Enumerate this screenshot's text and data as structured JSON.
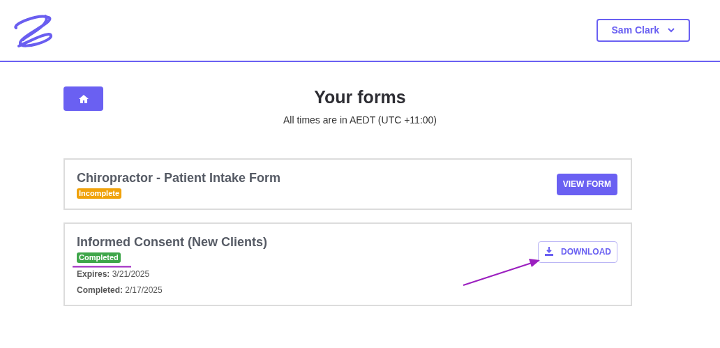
{
  "header": {
    "user_menu": {
      "label": "Sam Clark"
    }
  },
  "page": {
    "title": "Your forms",
    "subtitle": "All times are in AEDT (UTC +11:00)"
  },
  "forms": [
    {
      "title": "Chiropractor - Patient Intake Form",
      "status": {
        "kind": "incomplete",
        "label": "Incomplete"
      },
      "action": {
        "kind": "primary",
        "label": "VIEW FORM"
      }
    },
    {
      "title": "Informed Consent (New Clients)",
      "status": {
        "kind": "completed",
        "label": "Completed"
      },
      "details": [
        "**Expires:** 3/21/2025",
        "**Completed:** 2/17/2025"
      ],
      "action": {
        "kind": "outline",
        "label": "DOWNLOAD"
      }
    }
  ]
}
